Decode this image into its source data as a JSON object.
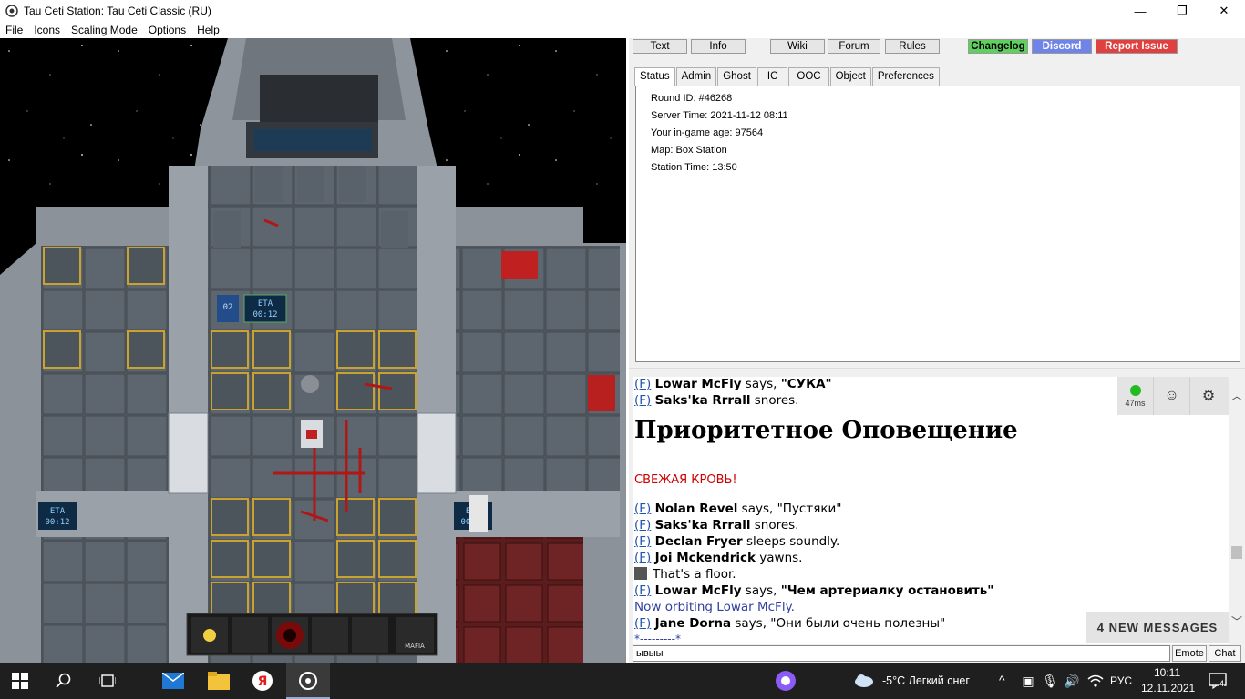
{
  "window": {
    "title": "Tau Ceti Station: Tau Ceti Classic (RU)",
    "minimize": "—",
    "maximize": "❐",
    "close": "✕"
  },
  "menu": [
    "File",
    "Icons",
    "Scaling Mode",
    "Options",
    "Help"
  ],
  "game": {
    "eta_label": "ETA",
    "eta_time": "00:12",
    "pod_number": "02",
    "hotbar_label": "MAFIA"
  },
  "toolbar": {
    "text": "Text",
    "info": "Info",
    "wiki": "Wiki",
    "forum": "Forum",
    "rules": "Rules",
    "changelog": "Changelog",
    "discord": "Discord",
    "report": "Report Issue",
    "colors": {
      "changelog": "#5fd05f",
      "discord": "#6f83e8",
      "report": "#e04040"
    }
  },
  "tabs": [
    "Status",
    "Admin",
    "Ghost",
    "IC",
    "OOC",
    "Object",
    "Preferences"
  ],
  "status": {
    "round_id": "Round ID: #46268",
    "server_time": "Server Time: 2021-11-12 08:11",
    "age": "Your in-game age: 97564",
    "map": "Map: Box Station",
    "station_time": "Station Time: 13:50"
  },
  "chat": {
    "f": "(F)",
    "l1_name": "Lowar McFly",
    "l1_rest": " says, ",
    "l1_quote": "\"СУКА\"",
    "l2_name": "Saks'ka Rrrall",
    "l2_rest": " snores.",
    "heading": "Приоритетное Оповещение",
    "alert": "СВЕЖАЯ КРОВЬ!",
    "l3_name": "Nolan Revel",
    "l3_rest": " says, \"Пустяки\"",
    "l4_name": "Saks'ka Rrrall",
    "l4_rest": " snores.",
    "l5_name": "Declan Fryer",
    "l5_rest": " sleeps soundly.",
    "l6_name": "Joi Mckendrick",
    "l6_rest": " yawns.",
    "l7_text": "That's a floor.",
    "l8_name": "Lowar McFly",
    "l8_rest": " says, ",
    "l8_quote": "\"Чем артериалку остановить\"",
    "l9_text": "Now orbiting Lowar McFly.",
    "l10_name": "Jane Dorna",
    "l10_rest": " says, \"Они были очень полезны\"",
    "l11_text": "*---------*",
    "ping": "47ms",
    "new_messages": "4 NEW MESSAGES"
  },
  "input": {
    "value": "ывыы",
    "emote": "Emote",
    "chat": "Chat"
  },
  "taskbar": {
    "weather": "-5°C  Легкий снег",
    "lang": "РУС",
    "time": "10:11",
    "date": "12.11.2021",
    "notifications": "4"
  }
}
